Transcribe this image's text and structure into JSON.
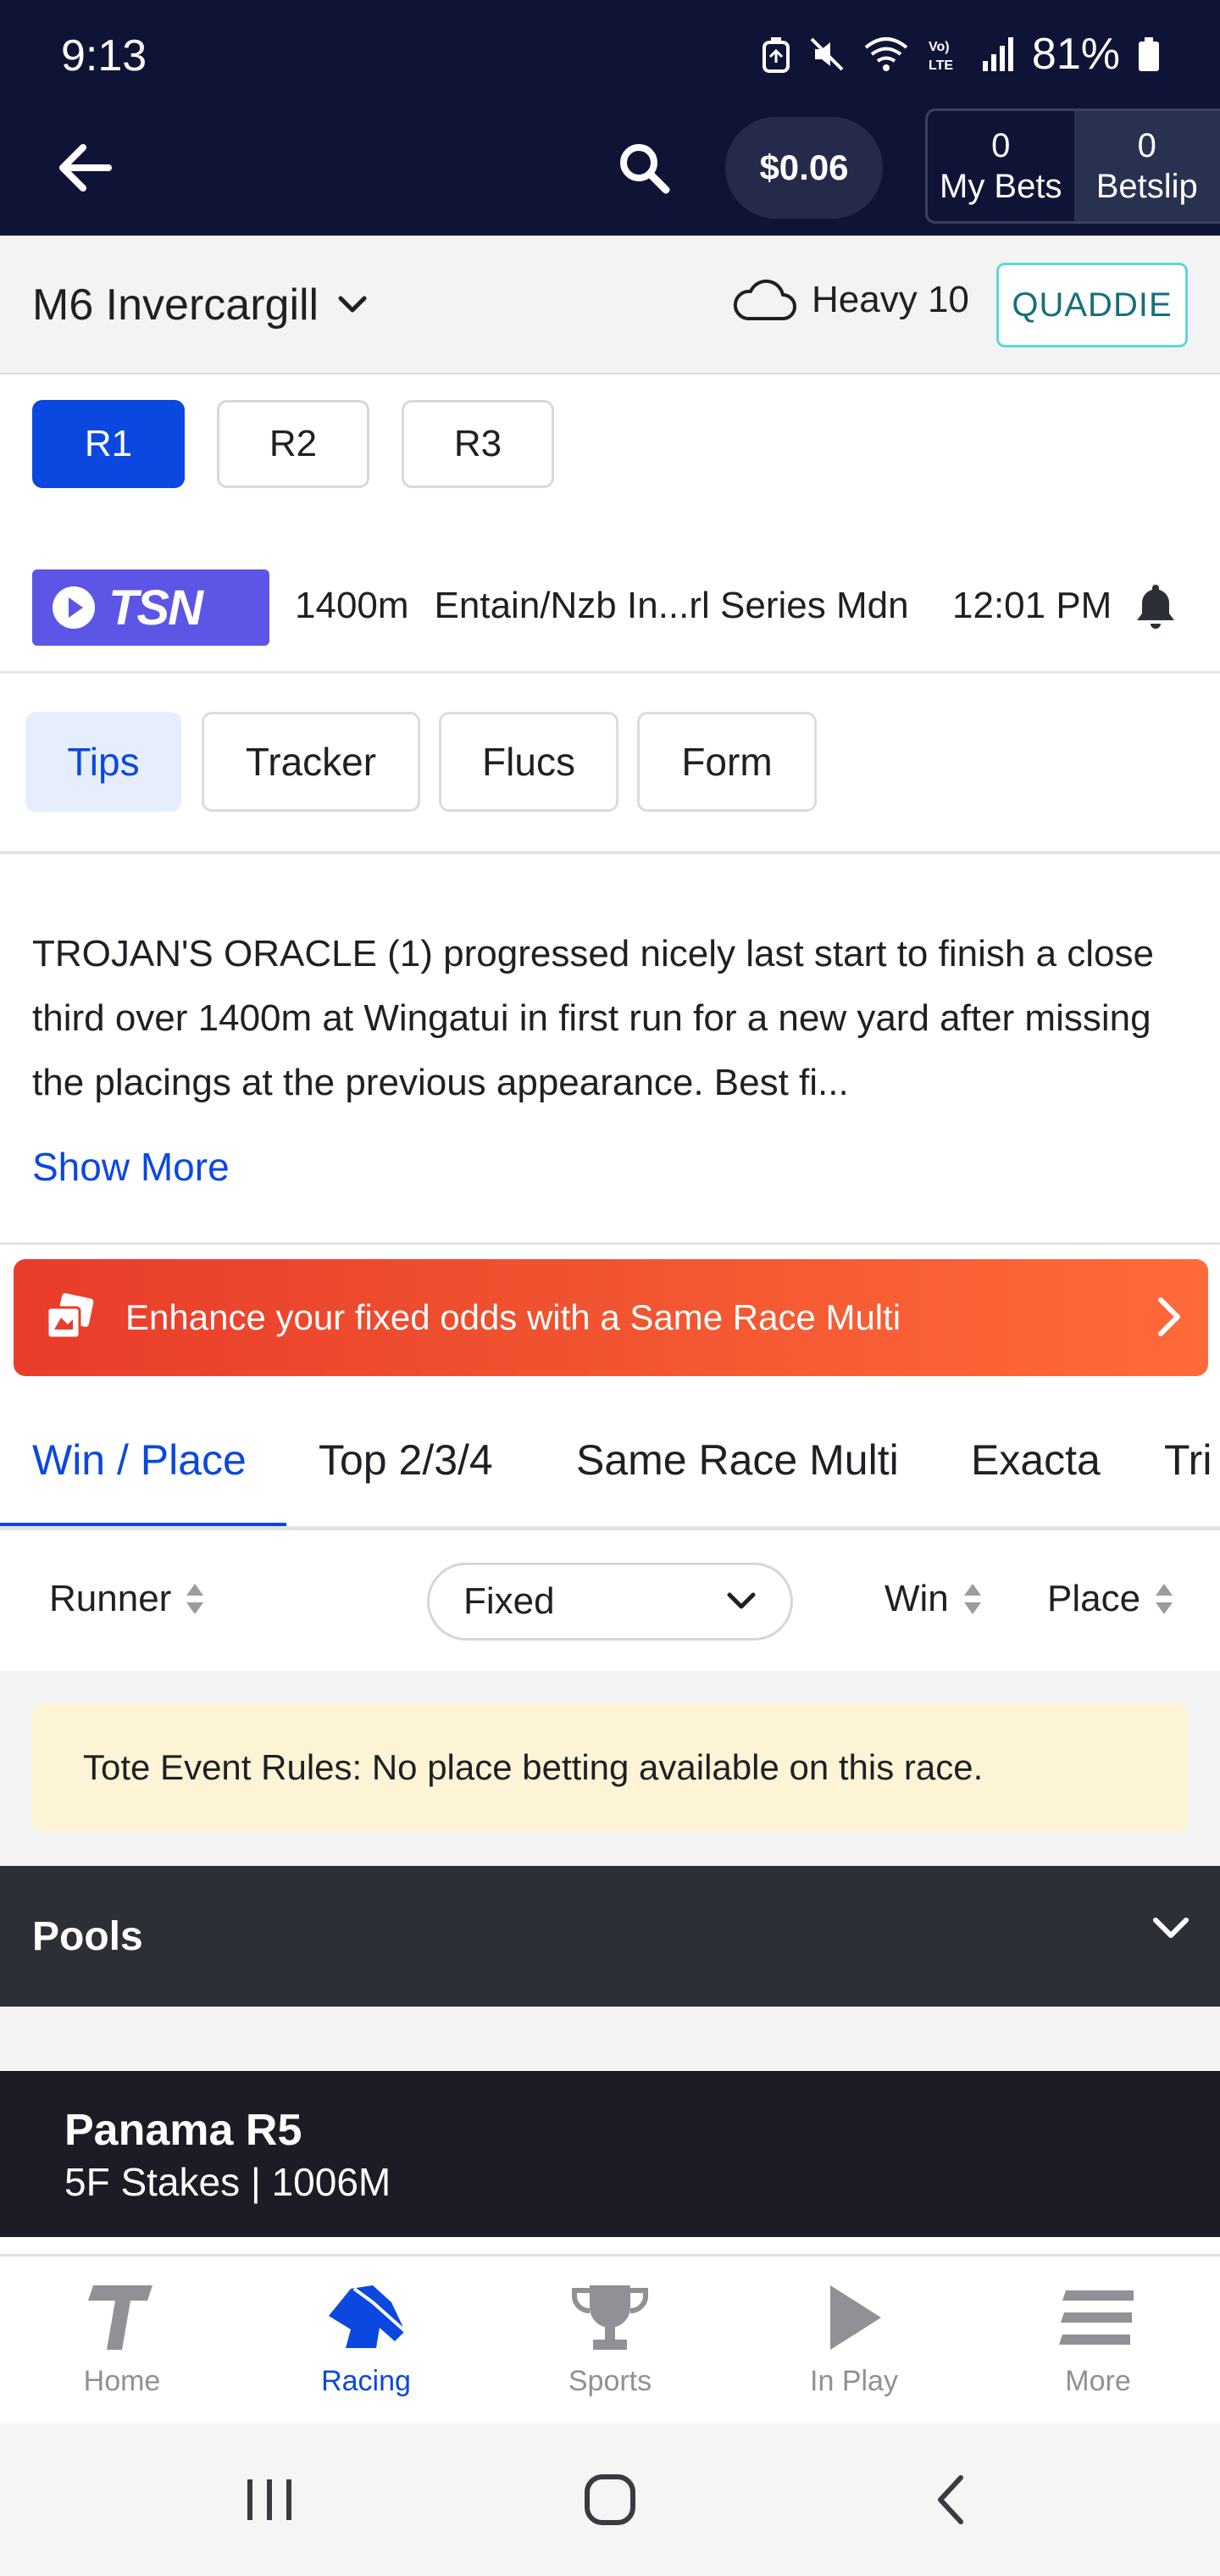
{
  "status_bar": {
    "time": "9:13",
    "battery": "81%",
    "icons": [
      "alarm-icon",
      "mute-icon",
      "wifi-icon",
      "volte-icon",
      "signal-icon",
      "battery-icon"
    ]
  },
  "header": {
    "balance": "$0.06",
    "my_bets_count": "0",
    "my_bets_label": "My Bets",
    "betslip_count": "0",
    "betslip_label": "Betslip"
  },
  "meeting": {
    "name": "M6 Invercargill",
    "track_condition": "Heavy 10",
    "quaddie_label": "QUADDIE"
  },
  "races": [
    {
      "label": "R1",
      "active": true
    },
    {
      "label": "R2",
      "active": false
    },
    {
      "label": "R3",
      "active": false
    }
  ],
  "race_info": {
    "broadcaster": "TSN",
    "distance": "1400m",
    "name": "Entain/Nzb In...rl Series Mdn",
    "time": "12:01 PM"
  },
  "sub_tabs": [
    {
      "label": "Tips",
      "active": true
    },
    {
      "label": "Tracker",
      "active": false
    },
    {
      "label": "Flucs",
      "active": false
    },
    {
      "label": "Form",
      "active": false
    }
  ],
  "tips": {
    "text": "TROJAN'S ORACLE (1) progressed nicely last start to finish a close third over 1400m at Wingatui in first run for a new yard after missing the placings at the previous appearance. Best fi...",
    "show_more": "Show More"
  },
  "promo": {
    "text": "Enhance your fixed odds with a Same Race Multi"
  },
  "market_tabs": [
    {
      "label": "Win / Place",
      "active": true
    },
    {
      "label": "Top 2/3/4",
      "active": false
    },
    {
      "label": "Same Race Multi",
      "active": false
    },
    {
      "label": "Exacta",
      "active": false
    },
    {
      "label": "Tri",
      "active": false
    }
  ],
  "runner_header": {
    "runner": "Runner",
    "odds_type": "Fixed",
    "win": "Win",
    "place": "Place"
  },
  "tote_rules": "Tote Event Rules: No place betting available on this race.",
  "pools_label": "Pools",
  "next_race": {
    "title": "Panama R5",
    "subtitle": "5F Stakes | 1006M"
  },
  "bottom_nav": [
    {
      "label": "Home",
      "icon": "tab-logo-icon",
      "active": false
    },
    {
      "label": "Racing",
      "icon": "horse-head-icon",
      "active": true
    },
    {
      "label": "Sports",
      "icon": "trophy-icon",
      "active": false
    },
    {
      "label": "In Play",
      "icon": "play-icon",
      "active": false
    },
    {
      "label": "More",
      "icon": "menu-icon",
      "active": false
    }
  ],
  "colors": {
    "header_bg": "#0f1437",
    "accent_blue": "#0b48e0",
    "promo_orange": "#f0522f",
    "tsn_purple": "#5c55e6",
    "quaddie_teal": "#5fd6d8"
  }
}
